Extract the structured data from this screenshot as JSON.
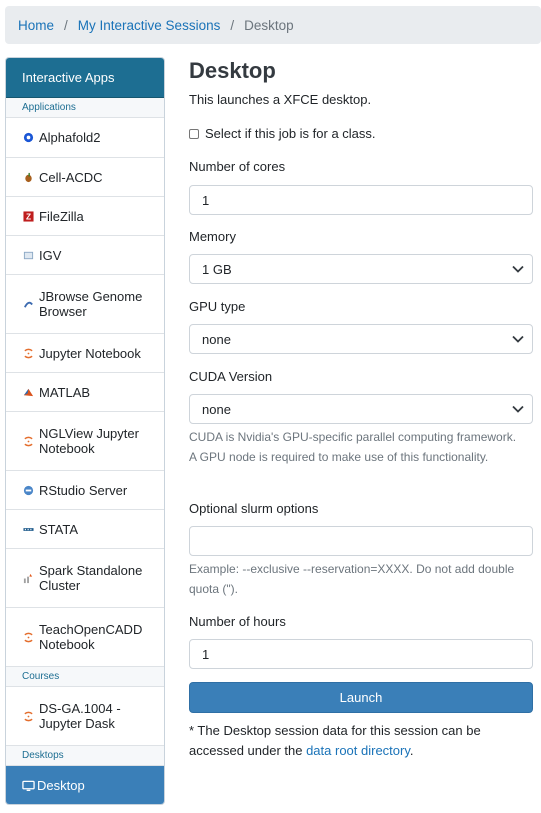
{
  "breadcrumb": {
    "home": "Home",
    "sessions": "My Interactive Sessions",
    "current": "Desktop",
    "separator": "/"
  },
  "sidebar": {
    "header": "Interactive Apps",
    "groups": {
      "applications": "Applications",
      "courses": "Courses",
      "desktops": "Desktops"
    },
    "apps": [
      {
        "label": "Alphafold2",
        "icon": "alphafold-icon"
      },
      {
        "label": "Cell-ACDC",
        "icon": "cell-acdc-icon"
      },
      {
        "label": "FileZilla",
        "icon": "filezilla-icon"
      },
      {
        "label": "IGV",
        "icon": "igv-icon"
      },
      {
        "label": "JBrowse Genome Browser",
        "icon": "jbrowse-icon"
      },
      {
        "label": "Jupyter Notebook",
        "icon": "jupyter-icon"
      },
      {
        "label": "MATLAB",
        "icon": "matlab-icon"
      },
      {
        "label": "NGLView Jupyter Notebook",
        "icon": "jupyter-icon"
      },
      {
        "label": "RStudio Server",
        "icon": "rstudio-icon"
      },
      {
        "label": "STATA",
        "icon": "stata-icon"
      },
      {
        "label": "Spark Standalone Cluster",
        "icon": "spark-icon"
      },
      {
        "label": "TeachOpenCADD Notebook",
        "icon": "jupyter-icon"
      }
    ],
    "courses": [
      {
        "label": "DS-GA.1004 - Jupyter Dask",
        "icon": "jupyter-icon"
      }
    ],
    "desktop": {
      "label": "Desktop",
      "icon": "monitor-icon"
    }
  },
  "main": {
    "title": "Desktop",
    "description": "This launches a XFCE desktop.",
    "class_checkbox_label": "Select if this job is for a class.",
    "cores": {
      "label": "Number of cores",
      "value": "1"
    },
    "memory": {
      "label": "Memory",
      "value": "1 GB"
    },
    "gpu": {
      "label": "GPU type",
      "value": "none"
    },
    "cuda": {
      "label": "CUDA Version",
      "value": "none",
      "help": "CUDA is Nvidia's GPU-specific parallel computing framework. A GPU node is required to make use of this functionality."
    },
    "slurm": {
      "label": "Optional slurm options",
      "value": "",
      "help": "Example: --exclusive --reservation=XXXX. Do not add double quota (\")."
    },
    "hours": {
      "label": "Number of hours",
      "value": "1"
    },
    "launch_label": "Launch",
    "footnote_before": "* The Desktop session data for this session can be accessed under the ",
    "footnote_link": "data root directory",
    "footnote_after": "."
  },
  "colors": {
    "header": "#1d6e92",
    "accent": "#3a7fb8",
    "link": "#1a73b8"
  }
}
